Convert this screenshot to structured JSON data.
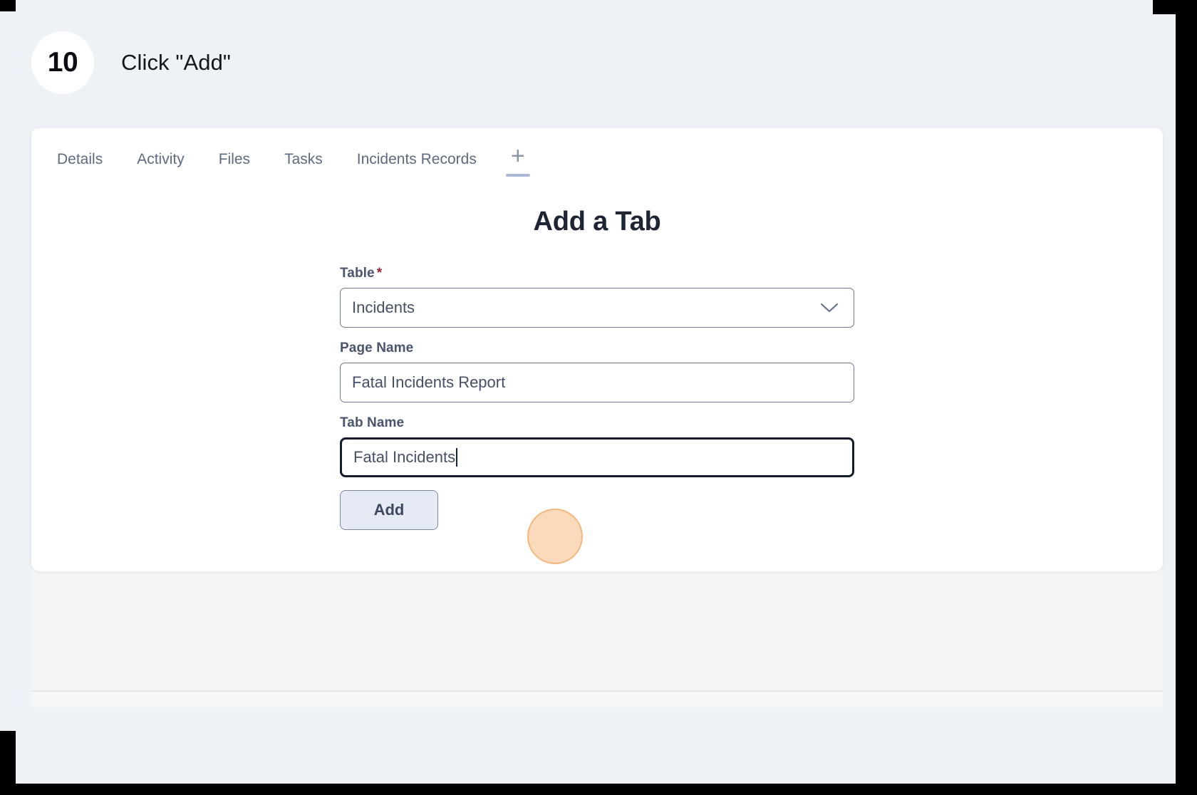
{
  "step": {
    "number": "10",
    "title": "Click \"Add\""
  },
  "tabs": [
    {
      "label": "Details",
      "active": false
    },
    {
      "label": "Activity",
      "active": false
    },
    {
      "label": "Files",
      "active": false
    },
    {
      "label": "Tasks",
      "active": false
    },
    {
      "label": "Incidents Records",
      "active": false
    },
    {
      "label": "+",
      "active": true,
      "icon": "plus-icon"
    }
  ],
  "form": {
    "heading": "Add a Tab",
    "table": {
      "label": "Table",
      "required_marker": "*",
      "value": "Incidents",
      "icon": "chevron-down-icon"
    },
    "page_name": {
      "label": "Page Name",
      "value": "Fatal Incidents Report"
    },
    "tab_name": {
      "label": "Tab Name",
      "value": "Fatal Incidents",
      "focused": true
    },
    "submit_label": "Add"
  },
  "colors": {
    "page_bg": "#eef1f6",
    "card_bg": "#ffffff",
    "heading": "#1d2433",
    "label": "#49556f",
    "required": "#9b2235",
    "tab_text": "#5e6a81",
    "tab_underline": "#aab6d6",
    "button_bg": "#e6eaf5",
    "focus_border": "#141b2e",
    "highlight": "#f39237"
  }
}
